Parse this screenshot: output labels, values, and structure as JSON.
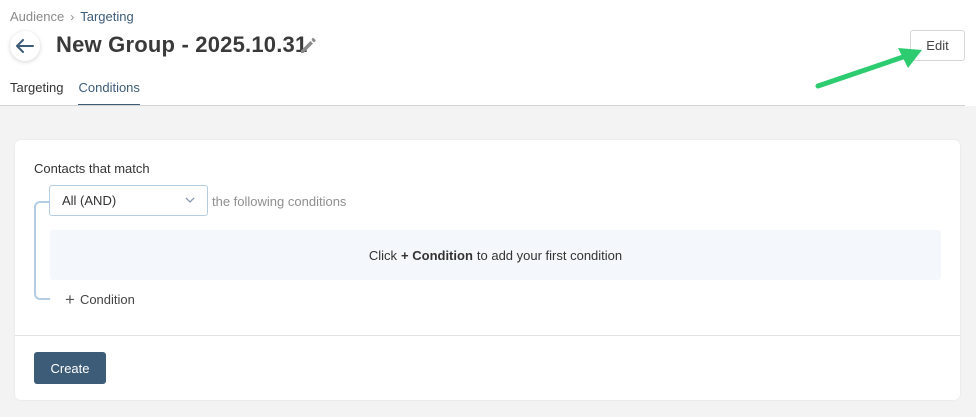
{
  "breadcrumb": {
    "root": "Audience",
    "separator": "›",
    "current": "Targeting"
  },
  "header": {
    "title": "New Group - 2025.10.31",
    "edit_label": "Edit"
  },
  "icons": {
    "back": "arrow-left-icon",
    "pencil": "pencil-icon",
    "chevron": "chevron-down-icon",
    "plus": "plus-icon"
  },
  "tabs": [
    {
      "label": "Targeting",
      "active": false
    },
    {
      "label": "Conditions",
      "active": true
    }
  ],
  "conditions": {
    "match_label": "Contacts that match",
    "operator_selected": "All (AND)",
    "following_text": "the following conditions",
    "empty_prefix": "Click",
    "empty_bold": "+ Condition",
    "empty_suffix": "to add your first condition",
    "add_label": "Condition",
    "add_symbol": "+"
  },
  "footer": {
    "create_label": "Create"
  },
  "colors": {
    "accent": "#3d5c78",
    "bracket": "#b4cde3",
    "annotation_arrow": "#2ecc71",
    "page_bg": "#f3f3f3"
  }
}
